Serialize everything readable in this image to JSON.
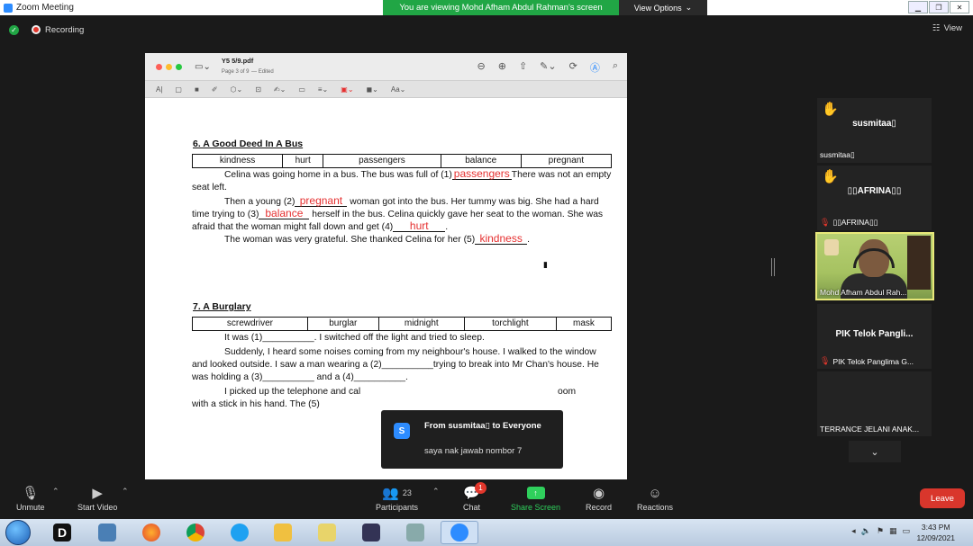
{
  "titlebar": {
    "app_title": "Zoom Meeting"
  },
  "banner": {
    "viewing_text": "You are viewing Mohd Afham Abdul Rahman's screen",
    "view_options": "View Options"
  },
  "topbar": {
    "recording": "Recording",
    "view": "View"
  },
  "document": {
    "filename": "Y5 5/9.pdf",
    "page_info": "Page 3 of 9",
    "edited": "— Edited",
    "section1": {
      "title": "6. A Good Deed In A Bus",
      "words": [
        "kindness",
        "hurt",
        "passengers",
        "balance",
        "pregnant"
      ],
      "p1_a": "Celina was going home in a bus. The bus was full of (1)",
      "p1_ans": "passengers",
      "p1_b": "There was not an empty seat left.",
      "p2_a": "Then a young (2)",
      "p2_ans": "pregnant",
      "p2_b": " woman got into the bus. Her tummy was big. She had a hard time trying to (3)",
      "p2_ans3": "balance",
      "p2_c": " herself in the bus. Celina quickly gave her seat to the woman. She was afraid that the woman might fall down and get (4)",
      "p2_ans4": "hurt",
      "p2_d": ".",
      "p3_a": "The woman was very grateful. She thanked Celina for her (5)",
      "p3_ans": "kindness",
      "p3_b": "."
    },
    "section2": {
      "title": "7. A Burglary",
      "words": [
        "screwdriver",
        "burglar",
        "midnight",
        "torchlight",
        "mask"
      ],
      "p1": "It was (1)__________. I switched off the light and tried to sleep.",
      "p2": "Suddenly, I heard some noises coming from my neighbour's house. I walked to the window and looked outside. I saw a man wearing a (2)__________trying to break into Mr Chan's house. He was holding a (3)__________ and a (4)__________.",
      "p3_a": "I picked up the telephone and cal",
      "p3_b": "oom",
      "p3_c": "with a stick in his hand. The (5)"
    }
  },
  "participants": [
    {
      "name": "susmitaa▯",
      "label": "susmitaa▯",
      "hand": true
    },
    {
      "name": "▯▯AFRINA▯▯",
      "label": "▯▯AFRINA▯▯",
      "hand": true
    },
    {
      "label": "Mohd Afham Abdul Rah..."
    },
    {
      "name": "PIK Telok Pangli...",
      "label": "PIK Telok Panglima G..."
    },
    {
      "label": "TERRANCE JELANI ANAK..."
    }
  ],
  "chat_popup": {
    "avatar_letter": "S",
    "from": "From susmitaa▯ to Everyone",
    "message": "saya nak jawab nombor 7"
  },
  "toolbar": {
    "unmute": "Unmute",
    "start_video": "Start Video",
    "participants": "Participants",
    "participants_count": "23",
    "chat": "Chat",
    "chat_badge": "1",
    "share_screen": "Share Screen",
    "record": "Record",
    "reactions": "Reactions",
    "leave": "Leave"
  },
  "taskbar": {
    "time": "3:43 PM",
    "date": "12/09/2021"
  },
  "colors": {
    "answer_red": "#e53030",
    "banner_green": "#21a645",
    "leave_red": "#d9362c",
    "accent_blue": "#2d8cff"
  }
}
